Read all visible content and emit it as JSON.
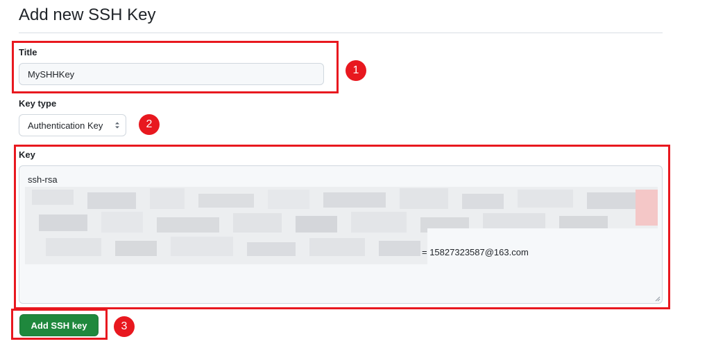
{
  "page": {
    "title": "Add new SSH Key"
  },
  "form": {
    "title_label": "Title",
    "title_value": "MySHHKey",
    "key_type_label": "Key type",
    "key_type_value": "Authentication Key",
    "key_label": "Key",
    "key_prefix": "ssh-rsa",
    "key_suffix": "= 15827323587@163.com",
    "submit_label": "Add SSH key"
  },
  "annotations": {
    "badges": [
      "1",
      "2",
      "3"
    ],
    "color": "#e8181f"
  },
  "colors": {
    "primary_button": "#1f883d",
    "input_background": "#f6f8fa",
    "border": "#d0d7de"
  }
}
